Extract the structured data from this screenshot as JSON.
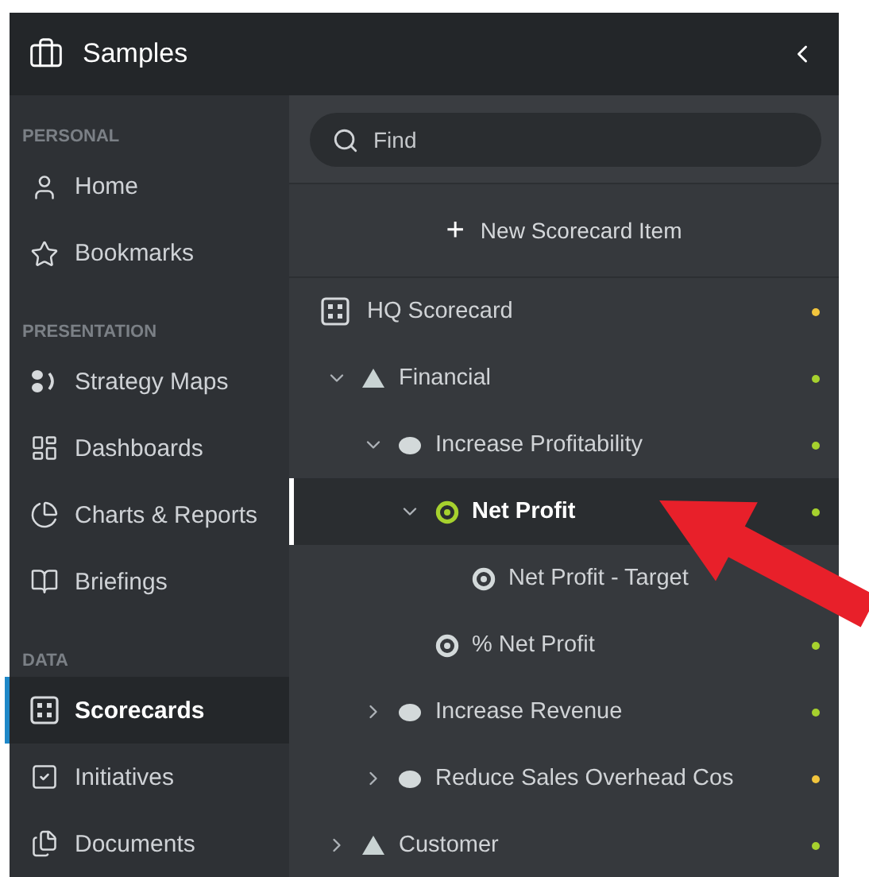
{
  "header": {
    "title": "Samples"
  },
  "sidebar": {
    "sections": [
      {
        "heading": "PERSONAL",
        "items": [
          {
            "label": "Home",
            "selected": false
          },
          {
            "label": "Bookmarks",
            "selected": false
          }
        ]
      },
      {
        "heading": "PRESENTATION",
        "items": [
          {
            "label": "Strategy Maps",
            "selected": false
          },
          {
            "label": "Dashboards",
            "selected": false
          },
          {
            "label": "Charts & Reports",
            "selected": false
          },
          {
            "label": "Briefings",
            "selected": false
          }
        ]
      },
      {
        "heading": "DATA",
        "items": [
          {
            "label": "Scorecards",
            "selected": true
          },
          {
            "label": "Initiatives",
            "selected": false
          },
          {
            "label": "Documents",
            "selected": false
          }
        ]
      }
    ]
  },
  "search": {
    "placeholder": "Find"
  },
  "new_item_button": {
    "icon": "+",
    "label": "New Scorecard Item"
  },
  "tree": [
    {
      "label": "HQ Scorecard",
      "kind": "scorecard",
      "selected": false,
      "color": "#f2c53d"
    },
    {
      "label": "Financial",
      "kind": "perspective",
      "selected": false,
      "expanded": true,
      "color": "#a6d12e",
      "children": [
        {
          "label": "Increase Profitability",
          "kind": "objective",
          "selected": false,
          "expanded": true,
          "color": "#a6d12e",
          "children": [
            {
              "label": "Net Profit",
              "kind": "measure",
              "selected": true,
              "expanded": true,
              "color": "#a6d12e",
              "children": [
                {
                  "label": "Net Profit - Target",
                  "kind": "measure",
                  "selected": false
                }
              ]
            },
            {
              "label": "% Net Profit",
              "kind": "measure",
              "selected": false,
              "color": "#a6d12e"
            }
          ]
        },
        {
          "label": "Increase Revenue",
          "kind": "objective",
          "selected": false,
          "expanded": false,
          "color": "#a6d12e"
        },
        {
          "label": "Reduce Sales Overhead Cos",
          "kind": "objective",
          "selected": false,
          "expanded": false,
          "color": "#f2c53d"
        }
      ]
    },
    {
      "label": "Customer",
      "kind": "perspective",
      "selected": false,
      "expanded": false,
      "color": "#a6d12e"
    }
  ]
}
